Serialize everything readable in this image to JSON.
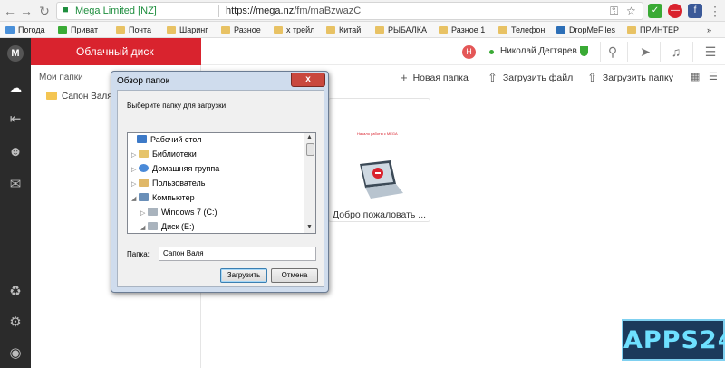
{
  "browser": {
    "secure_label": "Mega Limited [NZ]",
    "url_base": "https://mega.nz",
    "url_path": "/fm/maBzwazC",
    "bookmarks": [
      "Погода",
      "Приват",
      "Почта",
      "Шаринг",
      "Разное",
      "х трейл",
      "Китай",
      "РЫБАЛКА",
      "Разное 1",
      "Телефон",
      "DropMeFiles",
      "ПРИНТЕР"
    ],
    "more": "»"
  },
  "sidebar": {
    "brand": "Облачный диск",
    "tree_title": "Мои папки",
    "tree_item": "Сапон Валя"
  },
  "header": {
    "avatar_letter": "Н",
    "user_name": "Николай Дегтярев"
  },
  "toolbar": {
    "new_folder": "Новая папка",
    "upload_file": "Загрузить файл",
    "upload_folder": "Загрузить папку"
  },
  "card": {
    "tiny_text": "Начало работы с MEGA",
    "label": "Добро пожаловать ..."
  },
  "dialog": {
    "title": "Обзор папок",
    "prompt": "Выберите папку для загрузки",
    "folder_label": "Папка:",
    "folder_value": "Сапон Валя",
    "ok": "Загрузить",
    "cancel": "Отмена",
    "close_glyph": "x",
    "tree": [
      {
        "label": "Рабочий стол",
        "expander": "",
        "icon": "desktop"
      },
      {
        "label": "Библиотеки",
        "expander": "▷",
        "icon": "library"
      },
      {
        "label": "Домашняя группа",
        "expander": "▷",
        "icon": "homegroup"
      },
      {
        "label": "Пользователь",
        "expander": "▷",
        "icon": "user"
      },
      {
        "label": "Компьютер",
        "expander": "◢",
        "icon": "computer"
      },
      {
        "label": "Windows 7 (C:)",
        "expander": "▷",
        "icon": "drive"
      },
      {
        "label": "Диск (E:)",
        "expander": "◢",
        "icon": "drive"
      }
    ]
  },
  "watermark": "APPS24",
  "colors": {
    "brand_red": "#d9232e",
    "dark_nav": "#2b2b2b",
    "dialog_frame": "#cfdced"
  }
}
